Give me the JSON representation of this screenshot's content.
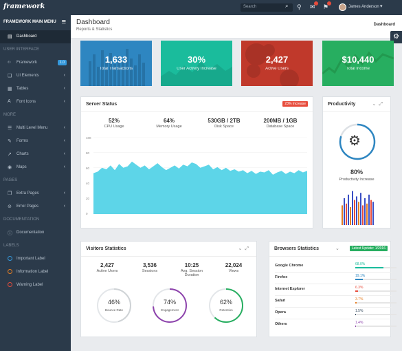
{
  "topbar": {
    "brand": "framework",
    "search_placeholder": "Search",
    "user_name": "James Anderson"
  },
  "sidebar": {
    "menu_title": "FRAMEWORK MAIN MENU",
    "dashboard": "Dashboard",
    "sections": {
      "ui": "USER INTERFACE",
      "more": "MORE",
      "pages": "PAGES",
      "documentation": "DOCUMENTATION",
      "labels": "LABELS"
    },
    "ui_items": [
      {
        "label": "Framework",
        "badge": "1.0"
      },
      {
        "label": "UI Elements"
      },
      {
        "label": "Tables"
      },
      {
        "label": "Font Icons"
      }
    ],
    "more_items": [
      {
        "label": "Multi Level Menu"
      },
      {
        "label": "Forms"
      },
      {
        "label": "Charts"
      },
      {
        "label": "Maps"
      }
    ],
    "pages_items": [
      {
        "label": "Extra Pages"
      },
      {
        "label": "Error Pages"
      }
    ],
    "doc_item": "Documentation",
    "label_items": [
      {
        "label": "Important Label",
        "color": "#3498db"
      },
      {
        "label": "Information Label",
        "color": "#e67e22"
      },
      {
        "label": "Warning Label",
        "color": "#e74c3c"
      }
    ]
  },
  "header": {
    "title": "Dashboard",
    "subtitle": "Reports & Statistics",
    "breadcrumb": "Dashboard"
  },
  "stats": [
    {
      "value": "1,633",
      "label": "Total Transactions",
      "color": "#2e86c1"
    },
    {
      "value": "30%",
      "label": "User Activity Increase",
      "color": "#1abc9c"
    },
    {
      "value": "2,427",
      "label": "Active Users",
      "color": "#c0392b"
    },
    {
      "value": "$10,440",
      "label": "Total Income",
      "color": "#27ae60"
    }
  ],
  "server": {
    "title": "Server Status",
    "tag": "23% Increase",
    "metrics": [
      {
        "value": "52%",
        "label": "CPU Usage"
      },
      {
        "value": "64%",
        "label": "Memory Usage"
      },
      {
        "value": "530GB / 2TB",
        "label": "Disk Space"
      },
      {
        "value": "200MB / 1GB",
        "label": "Database Space"
      }
    ],
    "y_ticks": [
      "100",
      "80",
      "60",
      "40",
      "20",
      "0"
    ]
  },
  "chart_data": {
    "type": "area",
    "ylim": [
      0,
      100
    ],
    "color": "#5dd5e8",
    "values": [
      53,
      55,
      60,
      58,
      63,
      57,
      65,
      60,
      62,
      68,
      64,
      60,
      63,
      58,
      62,
      66,
      61,
      57,
      60,
      63,
      59,
      64,
      62,
      67,
      65,
      60,
      62,
      64,
      58,
      61,
      57,
      60,
      56,
      58,
      55,
      57,
      53,
      56,
      52,
      55,
      54,
      57,
      51,
      54,
      56,
      52,
      55,
      53,
      57,
      54,
      56
    ]
  },
  "productivity": {
    "title": "Productivity",
    "value": "80%",
    "label": "Productivity Increase",
    "bars": [
      {
        "h": 0.55,
        "c": "#e67e22"
      },
      {
        "h": 0.75,
        "c": "#3a4ec4"
      },
      {
        "h": 0.6,
        "c": "#e74c3c"
      },
      {
        "h": 0.85,
        "c": "#3a4ec4"
      },
      {
        "h": 0.5,
        "c": "#e67e22"
      },
      {
        "h": 0.95,
        "c": "#3a4ec4"
      },
      {
        "h": 0.7,
        "c": "#e74c3c"
      },
      {
        "h": 0.8,
        "c": "#3a4ec4"
      },
      {
        "h": 0.65,
        "c": "#e67e22"
      },
      {
        "h": 0.9,
        "c": "#3a4ec4"
      },
      {
        "h": 0.55,
        "c": "#e74c3c"
      },
      {
        "h": 0.75,
        "c": "#3a4ec4"
      },
      {
        "h": 0.6,
        "c": "#e67e22"
      },
      {
        "h": 0.85,
        "c": "#3a4ec4"
      },
      {
        "h": 0.7,
        "c": "#e74c3c"
      },
      {
        "h": 0.65,
        "c": "#3a4ec4"
      }
    ]
  },
  "visitors": {
    "title": "Visitors Statistics",
    "metrics": [
      {
        "value": "2,427",
        "label": "Active Users"
      },
      {
        "value": "3,536",
        "label": "Sessions"
      },
      {
        "value": "10:25",
        "label": "Avg. Session Duration"
      },
      {
        "value": "22,024",
        "label": "Views"
      }
    ],
    "gauges": [
      {
        "value": "46%",
        "label": "Bounce Rate",
        "pct": 0.46,
        "color": "#cfd3d6"
      },
      {
        "value": "74%",
        "label": "Engagement",
        "pct": 0.74,
        "color": "#8e44ad"
      },
      {
        "value": "62%",
        "label": "Retention",
        "pct": 0.62,
        "color": "#27ae60"
      }
    ]
  },
  "browsers": {
    "title": "Browsers Statistics",
    "tag": "Latest Update: 1/2016",
    "rows": [
      {
        "name": "Google Chrome",
        "pct": "68.0%",
        "v": 0.68,
        "color": "#1abc9c"
      },
      {
        "name": "Firefox",
        "pct": "19.1%",
        "v": 0.191,
        "color": "#2e86c1"
      },
      {
        "name": "Internet Explorer",
        "pct": "6.3%",
        "v": 0.063,
        "color": "#e74c3c"
      },
      {
        "name": "Safari",
        "pct": "3.7%",
        "v": 0.037,
        "color": "#e67e22"
      },
      {
        "name": "Opera",
        "pct": "1.5%",
        "v": 0.015,
        "color": "#34495e"
      },
      {
        "name": "Others",
        "pct": "1.4%",
        "v": 0.014,
        "color": "#8e44ad"
      }
    ]
  }
}
